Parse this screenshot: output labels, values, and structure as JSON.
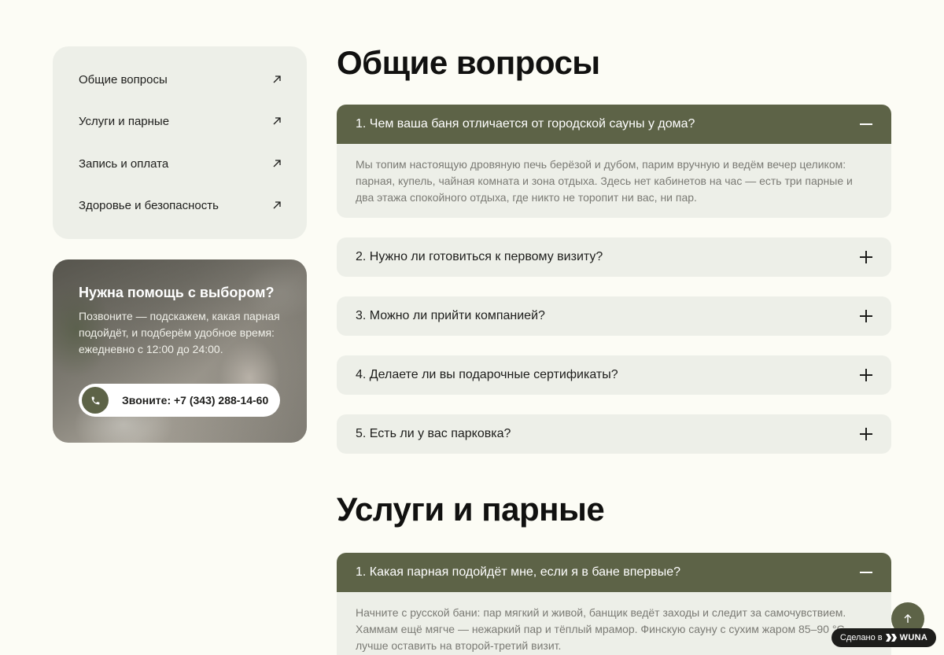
{
  "sidebar": {
    "items": [
      {
        "label": "Общие вопросы"
      },
      {
        "label": "Услуги и парные"
      },
      {
        "label": "Запись и оплата"
      },
      {
        "label": "Здоровье и безопасность"
      }
    ]
  },
  "help": {
    "title": "Нужна помощь с выбором?",
    "text": "Позвоните — подскажем, какая парная подойдёт, и подберём удобное время: ежедневно с 12:00 до 24:00.",
    "call_label": "Звоните: +7 (343) 288-14-60"
  },
  "sections": [
    {
      "title": "Общие вопросы",
      "questions": [
        {
          "q": "1. Чем ваша баня отличается от городской сауны у дома?",
          "a": "Мы топим настоящую дровяную печь берёзой и дубом, парим вручную и ведём вечер целиком: парная, купель, чайная комната и зона отдыха. Здесь нет кабинетов на час — есть три парные и два этажа спокойного отдыха, где никто не торопит ни вас, ни пар.",
          "open": true
        },
        {
          "q": "2. Нужно ли готовиться к первому визиту?",
          "open": false
        },
        {
          "q": "3. Можно ли прийти компанией?",
          "open": false
        },
        {
          "q": "4. Делаете ли вы подарочные сертификаты?",
          "open": false
        },
        {
          "q": "5. Есть ли у вас парковка?",
          "open": false
        }
      ]
    },
    {
      "title": "Услуги и парные",
      "questions": [
        {
          "q": "1. Какая парная подойдёт мне, если я в бане впервые?",
          "a": "Начните с русской бани: пар мягкий и живой, банщик ведёт заходы и следит за самочувствием. Хаммам ещё мягче — нежаркий пар и тёплый мрамор. Финскую сауну с сухим жаром 85–90 °C лучше оставить на второй-третий визит.",
          "open": true
        }
      ]
    }
  ],
  "badge": {
    "prefix": "Сделано в",
    "brand": "WUNA"
  },
  "colors": {
    "accent": "#5d6347",
    "background": "#fcfcf5",
    "card": "#edefe8"
  }
}
